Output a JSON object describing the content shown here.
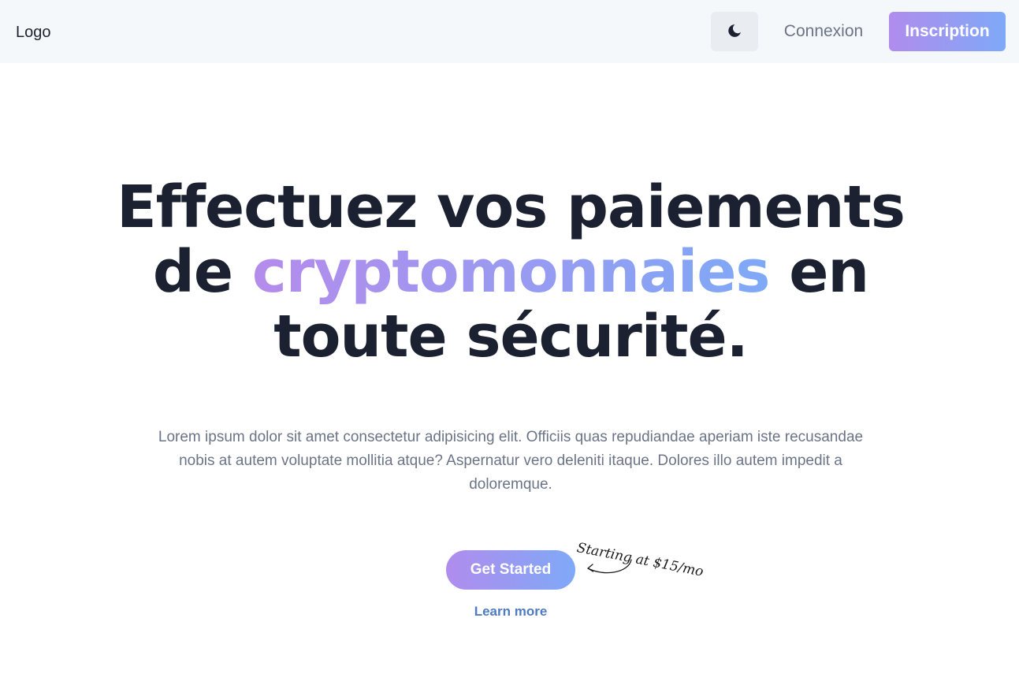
{
  "header": {
    "logo_text": "Logo",
    "theme_icon": "moon-icon",
    "login_label": "Connexion",
    "signup_label": "Inscription"
  },
  "hero": {
    "title_part1": "Effectuez vos paiements de ",
    "title_highlight": "cryptomonnaies",
    "title_part2": " en toute sécurité.",
    "subtitle": "Lorem ipsum dolor sit amet consectetur adipisicing elit. Officiis quas repudiandae aperiam iste recusandae nobis at autem voluptate mollitia atque? Aspernatur vero deleniti itaque. Dolores illo autem impedit a doloremque.",
    "cta_label": "Get Started",
    "secondary_label": "Learn more",
    "price_note": "Starting at $15/mo"
  },
  "colors": {
    "gradient_start": "#b08ced",
    "gradient_end": "#7fa9f7",
    "title": "#1b2130",
    "muted_text": "#6b7487",
    "link": "#4f7bc4",
    "nav_bg": "#f5f8fb"
  }
}
